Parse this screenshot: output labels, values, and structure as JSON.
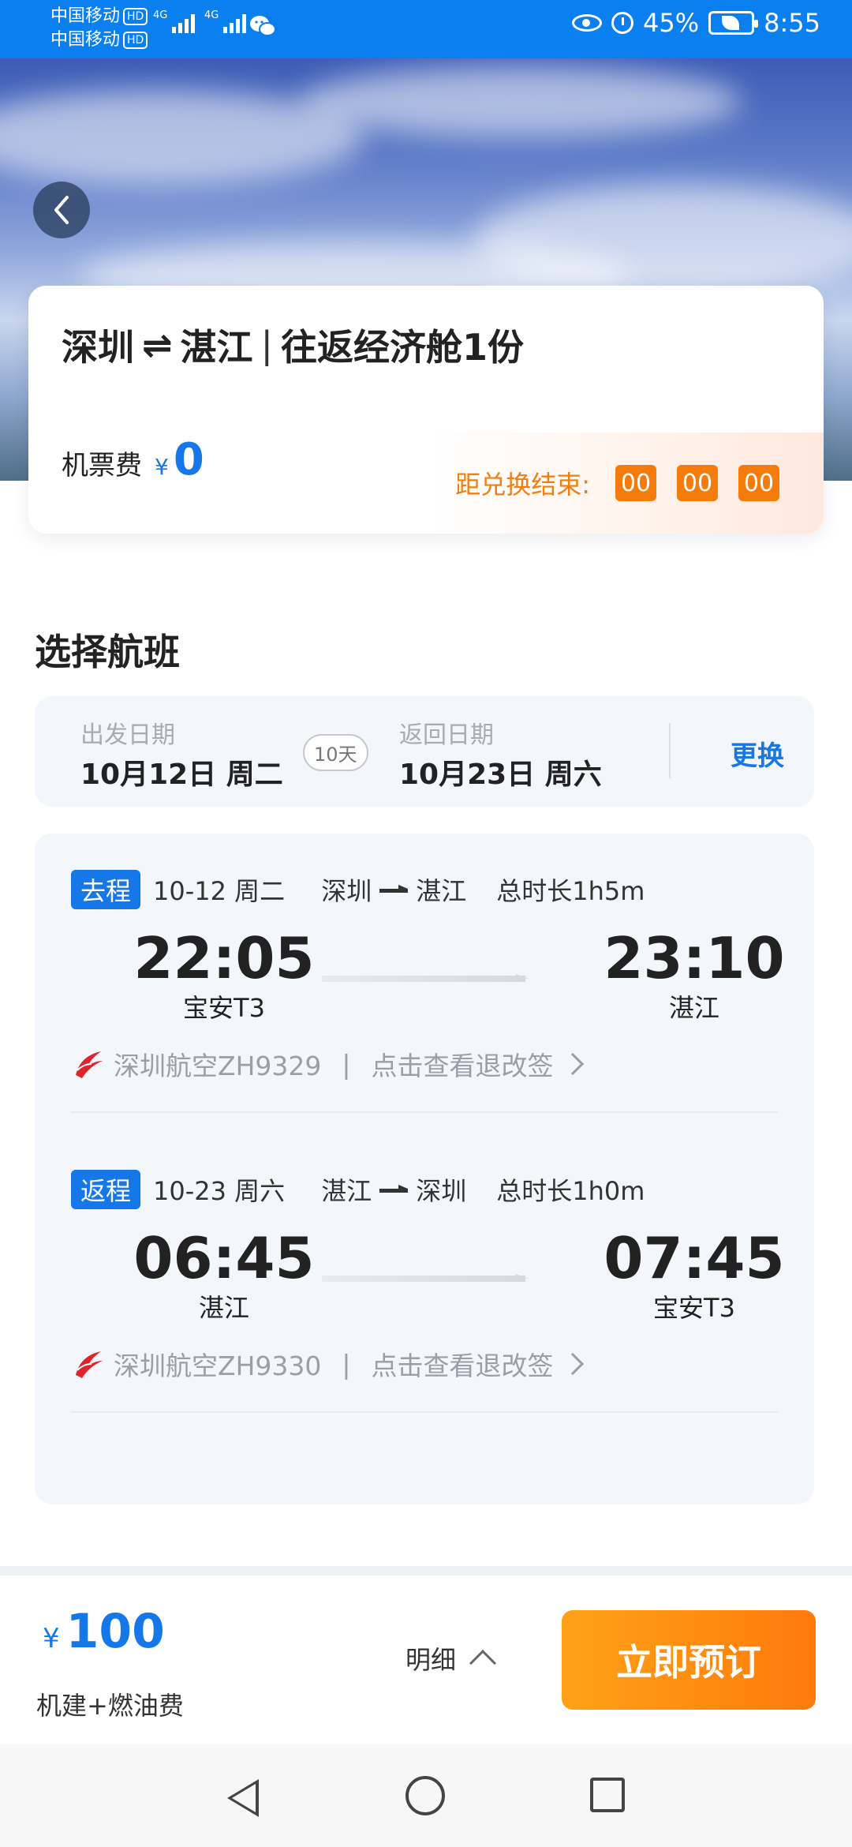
{
  "status_bar": {
    "carrier1": "中国移动",
    "carrier2": "中国移动",
    "hd": "HD",
    "network": "4G",
    "battery_pct": "45%",
    "time": "8:55"
  },
  "summary": {
    "title_from": "深圳",
    "title_swap_symbol": "⇌",
    "title_to": "湛江",
    "title_sep": "|",
    "title_desc": "往返经济舱1份",
    "fee_label": "机票费",
    "currency": "¥",
    "fee_value": "0",
    "countdown_label": "距兑换结束:",
    "countdown": [
      "00",
      "00",
      "00"
    ]
  },
  "section_title": "选择航班",
  "dates": {
    "depart_label": "出发日期",
    "depart_value": "10月12日 周二",
    "duration_badge": "10天",
    "return_label": "返回日期",
    "return_value": "10月23日 周六",
    "change_label": "更换"
  },
  "legs": [
    {
      "tag": "去程",
      "date": "10-12 周二",
      "from_city": "深圳",
      "to_city": "湛江",
      "duration": "总时长1h5m",
      "dep_time": "22:05",
      "dep_airport": "宝安T3",
      "arr_time": "23:10",
      "arr_airport": "湛江",
      "airline": "深圳航空ZH9329",
      "pipe": "|",
      "rules_link": "点击查看退改签"
    },
    {
      "tag": "返程",
      "date": "10-23 周六",
      "from_city": "湛江",
      "to_city": "深圳",
      "duration": "总时长1h0m",
      "dep_time": "06:45",
      "dep_airport": "湛江",
      "arr_time": "07:45",
      "arr_airport": "宝安T3",
      "airline": "深圳航空ZH9330",
      "pipe": "|",
      "rules_link": "点击查看退改签"
    }
  ],
  "bottom": {
    "currency": "¥",
    "price": "100",
    "price_sub": "机建+燃油费",
    "detail_label": "明细",
    "book_label": "立即预订"
  },
  "colors": {
    "accent": "#1677e8",
    "status_bar": "#0a7ff0",
    "countdown": "#f57c0a",
    "book_button_start": "#ffa216",
    "book_button_end": "#ff7a0c"
  },
  "icons": [
    "back-icon",
    "eye-icon",
    "alarm-icon",
    "battery-icon",
    "wechat-icon",
    "airline-logo-icon",
    "chevron-right-icon",
    "chevron-up-icon"
  ]
}
